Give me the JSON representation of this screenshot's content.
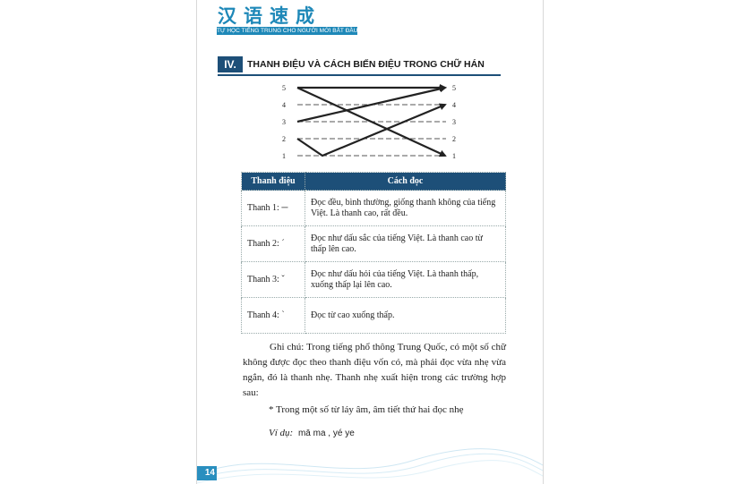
{
  "header": {
    "title_cn": "汉语速成",
    "subtitle": "TỰ HỌC TIẾNG TRUNG CHO NGƯỜI MỚI BẮT ĐẦU"
  },
  "section": {
    "number": "IV.",
    "title": "THANH ĐIỆU VÀ CÁCH BIẾN ĐIỆU TRONG CHỮ HÁN"
  },
  "diagram": {
    "left_levels": [
      "5",
      "4",
      "3",
      "2",
      "1"
    ],
    "right_levels": [
      "5",
      "4",
      "3",
      "2",
      "1"
    ]
  },
  "table": {
    "headers": [
      "Thanh điệu",
      "Cách đọc"
    ],
    "rows": [
      {
        "name": "Thanh 1: ─",
        "desc": "Đọc đều, bình thường, giống thanh không của tiếng Việt. Là thanh cao, rất đều."
      },
      {
        "name": "Thanh 2: ˊ",
        "desc": "Đọc như dấu sắc của tiếng Việt. Là thanh cao từ thấp lên cao."
      },
      {
        "name": "Thanh 3: ˇ",
        "desc": "Đọc như dấu hỏi của tiếng Việt. Là thanh thấp, xuống thấp lại lên cao."
      },
      {
        "name": "Thanh 4: ˋ",
        "desc": "Đọc từ cao xuống thấp."
      }
    ]
  },
  "note": "Ghi chú: Trong tiếng phổ thông Trung Quốc, có một số chữ không được đọc theo thanh điệu vốn có, mà phải đọc vừa nhẹ vừa ngắn, đó là thanh nhẹ. Thanh nhẹ xuất hiện trong các trường hợp sau:",
  "bullet": "* Trong một số từ láy âm, âm tiết thứ hai đọc nhẹ",
  "example": {
    "label": "Ví dụ:",
    "pinyin": "mā ma , yé ye"
  },
  "page_number": "14",
  "colors": {
    "accent_blue": "#1e88b8",
    "section_navy": "#1d4f78"
  }
}
